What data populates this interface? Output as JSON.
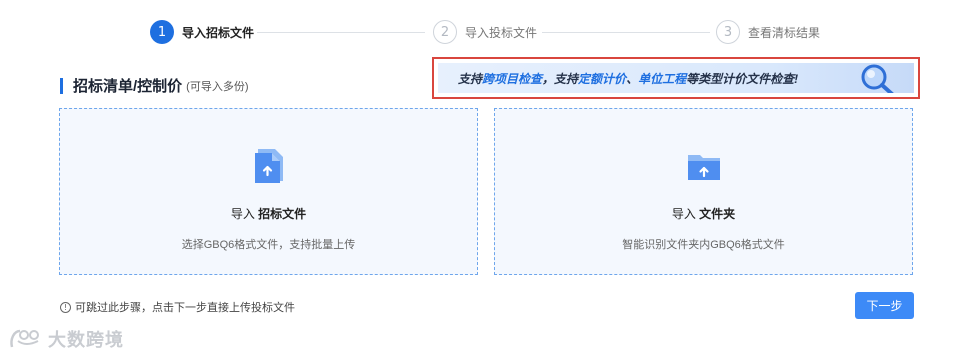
{
  "stepper": {
    "steps": [
      {
        "number": "1",
        "label": "导入招标文件",
        "state": "active"
      },
      {
        "number": "2",
        "label": "导入投标文件",
        "state": "inactive"
      },
      {
        "number": "3",
        "label": "查看清标结果",
        "state": "inactive"
      }
    ]
  },
  "section": {
    "title": "招标清单/控制价",
    "subtitle": "(可导入多份)"
  },
  "banner": {
    "part1": "支持",
    "hl1": "跨项目检查",
    "part2": "，支持",
    "hl2": "定额计价",
    "part3": "、",
    "hl3": "单位工程",
    "part4": "等类型计价文件检查!"
  },
  "cards": {
    "left": {
      "prefix": "导入",
      "title": "招标文件",
      "desc": "选择GBQ6格式文件，支持批量上传",
      "icon": "file-upload-icon"
    },
    "right": {
      "prefix": "导入",
      "title": "文件夹",
      "desc": "智能识别文件夹内GBQ6格式文件",
      "icon": "folder-upload-icon"
    }
  },
  "footer": {
    "hint": "可跳过此步骤，点击下一步直接上传投标文件",
    "next_label": "下一步"
  },
  "watermark": {
    "text": "大数跨境"
  },
  "colors": {
    "accent": "#1e6fe0",
    "button": "#3d8af7",
    "banner_border": "#d9463e",
    "card_border": "#6ea6ec"
  }
}
